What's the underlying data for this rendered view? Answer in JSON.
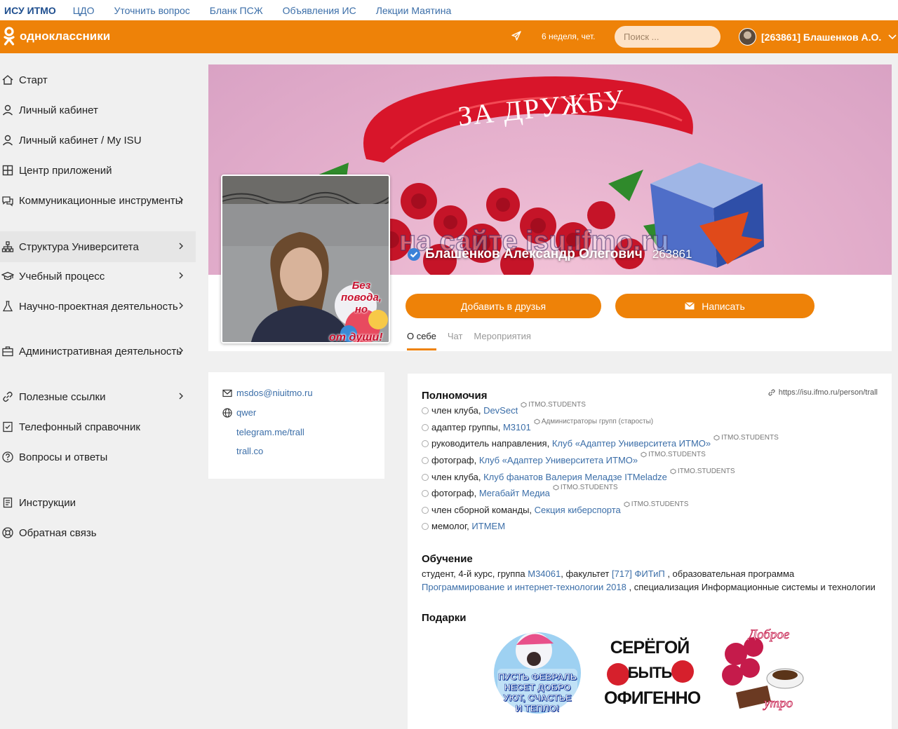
{
  "topbar": {
    "brand": "ИСУ ИТМО",
    "links": [
      "ЦДО",
      "Уточнить вопрос",
      "Бланк ПСЖ",
      "Объявления ИС",
      "Лекции Маятина"
    ]
  },
  "header": {
    "logo_text": "одноклассники",
    "week_text": "6 неделя, чет.",
    "search_placeholder": "Поиск ...",
    "user_label": "[263861] Блашенков А.О.",
    "accent_color": "#ee8208"
  },
  "sidebar": {
    "items": [
      {
        "label": "Старт",
        "icon": "home-icon"
      },
      {
        "label": "Личный кабинет",
        "icon": "user-icon"
      },
      {
        "label": "Личный кабинет / My ISU",
        "icon": "user-icon"
      },
      {
        "label": "Центр приложений",
        "icon": "grid-icon"
      },
      {
        "label": "Коммуникационные инструменты",
        "icon": "chat-icon",
        "submenu": true
      },
      {
        "label": "Структура Университета",
        "icon": "structure-icon",
        "submenu": true,
        "active": true
      },
      {
        "label": "Учебный процесс",
        "icon": "graduation-cap-icon",
        "submenu": true
      },
      {
        "label": "Научно-проектная деятельность",
        "icon": "flask-icon",
        "submenu": true
      },
      {
        "label": "Административная деятельность",
        "icon": "briefcase-icon",
        "submenu": true
      },
      {
        "label": "Полезные ссылки",
        "icon": "link-icon",
        "submenu": true
      },
      {
        "label": "Телефонный справочник",
        "icon": "phone-book-icon"
      },
      {
        "label": "Вопросы и ответы",
        "icon": "question-icon"
      },
      {
        "label": "Инструкции",
        "icon": "document-icon"
      },
      {
        "label": "Обратная связь",
        "icon": "feedback-icon"
      }
    ]
  },
  "profile": {
    "cover_banner": "ЗА ДРУЖБУ",
    "cover_watermark": "на сайте isu.ifmo.ru",
    "sticker_top": "Без повода, но",
    "sticker_bottom": "от души!",
    "name": "Блашенков Александр Олегович",
    "id": "263861",
    "add_friend": "Добавить в друзья",
    "write": "Написать",
    "tabs": [
      "О себе",
      "Чат",
      "Мероприятия"
    ]
  },
  "contacts": {
    "email": "msdos@niuitmo.ru",
    "site": "qwer",
    "links": [
      "telegram.me/trall",
      "trall.co"
    ]
  },
  "permissions": {
    "title": "Полномочия",
    "profile_link": "https://isu.ifmo.ru/person/trall",
    "items": [
      {
        "role": "член клуба,",
        "org": "DevSect",
        "tag": "ITMO.STUDENTS"
      },
      {
        "role": "адаптер группы,",
        "org": "M3101",
        "tag": "Администраторы групп (старосты)"
      },
      {
        "role": "руководитель направления,",
        "org": "Клуб «Адаптер Университета ИТМО»",
        "tag": "ITMO.STUDENTS"
      },
      {
        "role": "фотограф,",
        "org": "Клуб «Адаптер Университета ИТМО»",
        "tag": "ITMO.STUDENTS"
      },
      {
        "role": "член клуба,",
        "org": "Клуб фанатов Валерия Меладзе ITMeladze",
        "tag": "ITMO.STUDENTS"
      },
      {
        "role": "фотограф,",
        "org": "Мегабайт Медиа",
        "tag": "ITMO.STUDENTS"
      },
      {
        "role": "член сборной команды,",
        "org": "Секция киберспорта",
        "tag": "ITMO.STUDENTS"
      },
      {
        "role": "мемолог,",
        "org": "ИТМЕМ",
        "tag": ""
      }
    ]
  },
  "education": {
    "title": "Обучение",
    "p1": "студент, 4-й курс, группа",
    "group": "M34061",
    "p2": ", факультет",
    "faculty": "[717] ФИТиП",
    "p3": ", образовательная программа",
    "program": "Программирование и интернет-технологии 2018",
    "p4": ", специализация Информационные системы и технологии"
  },
  "gifts": {
    "title": "Подарки",
    "gift1": [
      "ПУСТЬ ФЕВРАЛЬ",
      "НЕСЕТ ДОБРО",
      "УЮТ, СЧАСТЬЕ",
      "И ТЕПЛО!"
    ],
    "gift2": [
      "СЕРЁГОЙ",
      "БЫТЬ",
      "ОФИГЕННО"
    ],
    "gift3": [
      "Доброе",
      "утро"
    ]
  }
}
